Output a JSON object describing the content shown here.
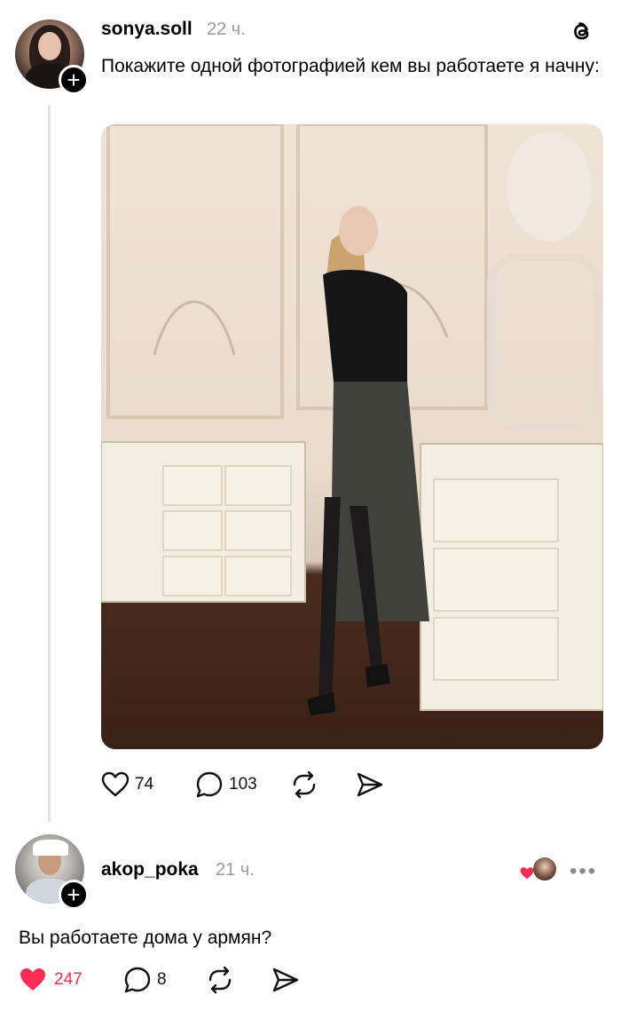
{
  "post": {
    "username": "sonya.soll",
    "time": "22 ч.",
    "text": "Покажите одной фотографией кем вы работаете я начну:",
    "likes": "74",
    "replies": "103"
  },
  "reply": {
    "username": "akop_poka",
    "time": "21 ч.",
    "text": "Вы работаете дома у армян?",
    "likes": "247",
    "replies": "8"
  },
  "colors": {
    "liked_heart": "#ff2d55",
    "muted": "#9a9a9a"
  },
  "icons": {
    "like": "heart-icon",
    "reply": "comment-bubble-icon",
    "repost": "repost-icon",
    "share": "send-icon",
    "app": "threads-logo-icon",
    "follow": "plus-icon",
    "more": "more-horizontal-icon"
  }
}
